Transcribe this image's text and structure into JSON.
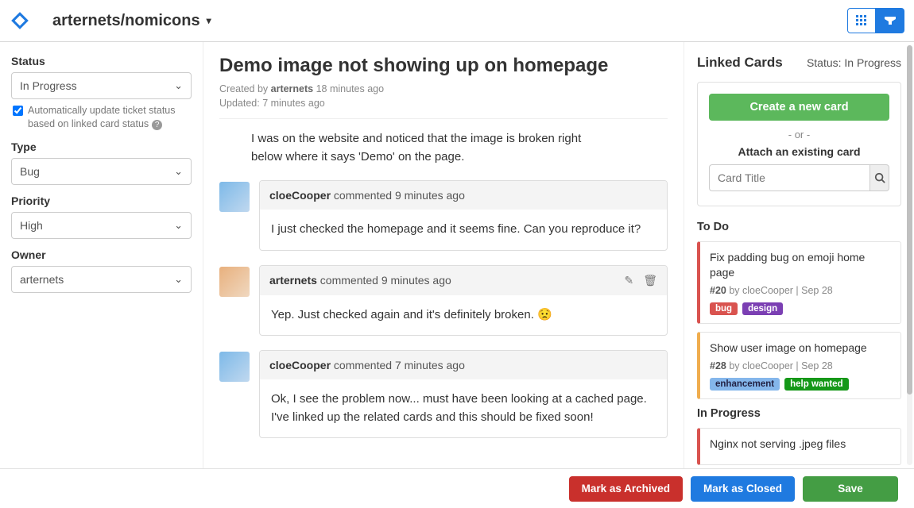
{
  "header": {
    "repo": "arternets/nomicons"
  },
  "left": {
    "status": {
      "label": "Status",
      "value": "In Progress"
    },
    "auto_status_text": "Automatically update ticket status based on linked card status",
    "type": {
      "label": "Type",
      "value": "Bug"
    },
    "priority": {
      "label": "Priority",
      "value": "High"
    },
    "owner": {
      "label": "Owner",
      "value": "arternets"
    }
  },
  "issue": {
    "title": "Demo image not showing up on homepage",
    "created_by": "arternets",
    "created_ago": "18 minutes ago",
    "updated_ago": "7 minutes ago",
    "body": "I was on the website and noticed that the image is broken right below where it says 'Demo' on the page."
  },
  "comments": [
    {
      "author": "cloeCooper",
      "ago": "9 minutes ago",
      "body": "I just checked the homepage and it seems fine. Can you reproduce it?",
      "own": false
    },
    {
      "author": "arternets",
      "ago": "9 minutes ago",
      "body": "Yep. Just checked again and it's definitely broken. 😟",
      "own": true
    },
    {
      "author": "cloeCooper",
      "ago": "7 minutes ago",
      "body": "Ok, I see the problem now... must have been looking at a cached page. I've linked up the related cards and this should be fixed soon!",
      "own": false
    }
  ],
  "linked": {
    "title": "Linked Cards",
    "status_label": "Status: In Progress",
    "create_btn": "Create a new card",
    "or": "- or -",
    "attach_label": "Attach an existing card",
    "search_placeholder": "Card Title",
    "columns": {
      "todo": {
        "title": "To Do",
        "cards": [
          {
            "title": "Fix padding bug on emoji home page",
            "num": "#20",
            "by": "cloeCooper",
            "date": "Sep 28",
            "tags": [
              "bug",
              "design"
            ],
            "stripe": "red"
          },
          {
            "title": "Show user image on homepage",
            "num": "#28",
            "by": "cloeCooper",
            "date": "Sep 28",
            "tags": [
              "enhancement",
              "help wanted"
            ],
            "stripe": "orange"
          }
        ]
      },
      "in_progress": {
        "title": "In Progress",
        "cards": [
          {
            "title": "Nginx not serving .jpeg files",
            "num": "",
            "by": "",
            "date": "",
            "tags": [],
            "stripe": "red"
          }
        ]
      }
    }
  },
  "footer": {
    "archive": "Mark as Archived",
    "closed": "Mark as Closed",
    "save": "Save"
  }
}
